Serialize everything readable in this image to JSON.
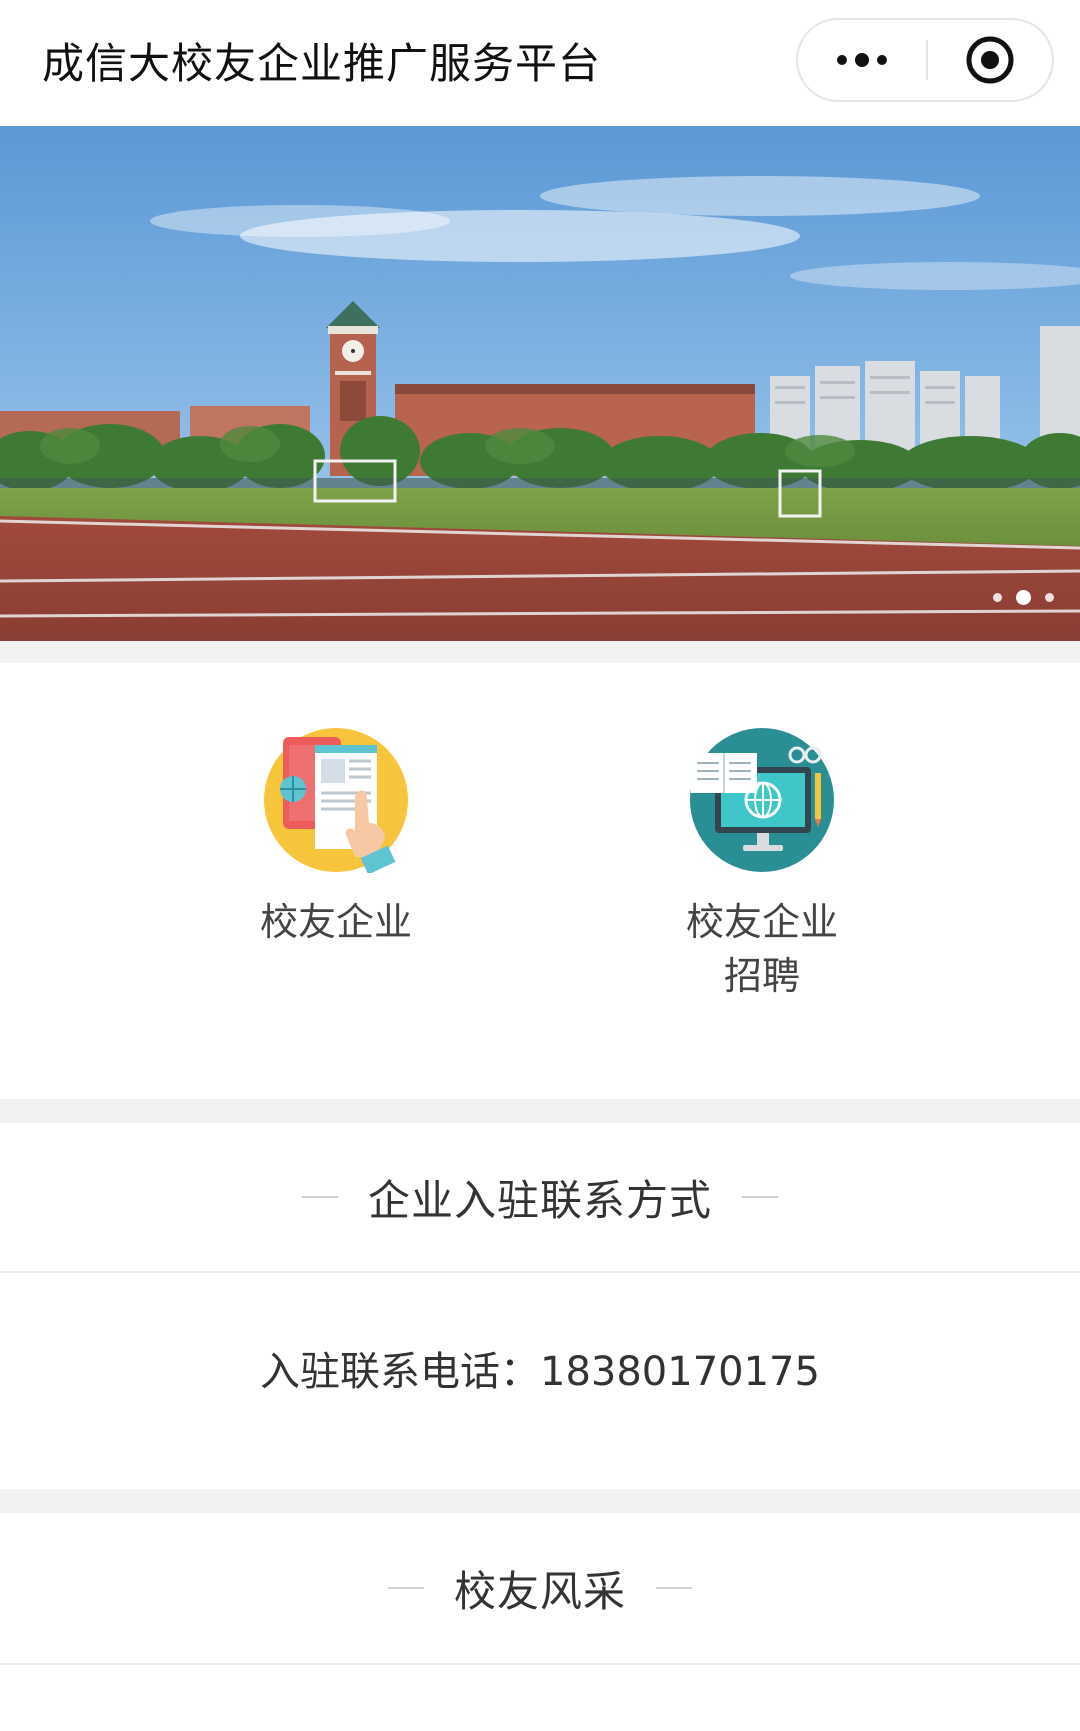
{
  "navbar": {
    "title": "成信大校友企业推广服务平台",
    "more_icon": "more-dots-icon",
    "close_icon": "target-circle-icon"
  },
  "banner": {
    "description_icon": "campus-photo",
    "slide_count": 3,
    "active_slide": 2
  },
  "features": [
    {
      "label": "校友企业",
      "icon": "web-browsing-hand-icon"
    },
    {
      "label": "校友企业\n招聘",
      "icon": "computer-book-globe-icon"
    }
  ],
  "contact": {
    "title": "企业入驻联系方式",
    "phone_text": "入驻联系电话：18380170175"
  },
  "alumni": {
    "title": "校友风采"
  },
  "colors": {
    "page_bg": "#f2f2f2",
    "card_bg": "#ffffff",
    "title_text": "#333333",
    "feature1_circle": "#f6c53c",
    "feature2_circle": "#2a8f95"
  }
}
